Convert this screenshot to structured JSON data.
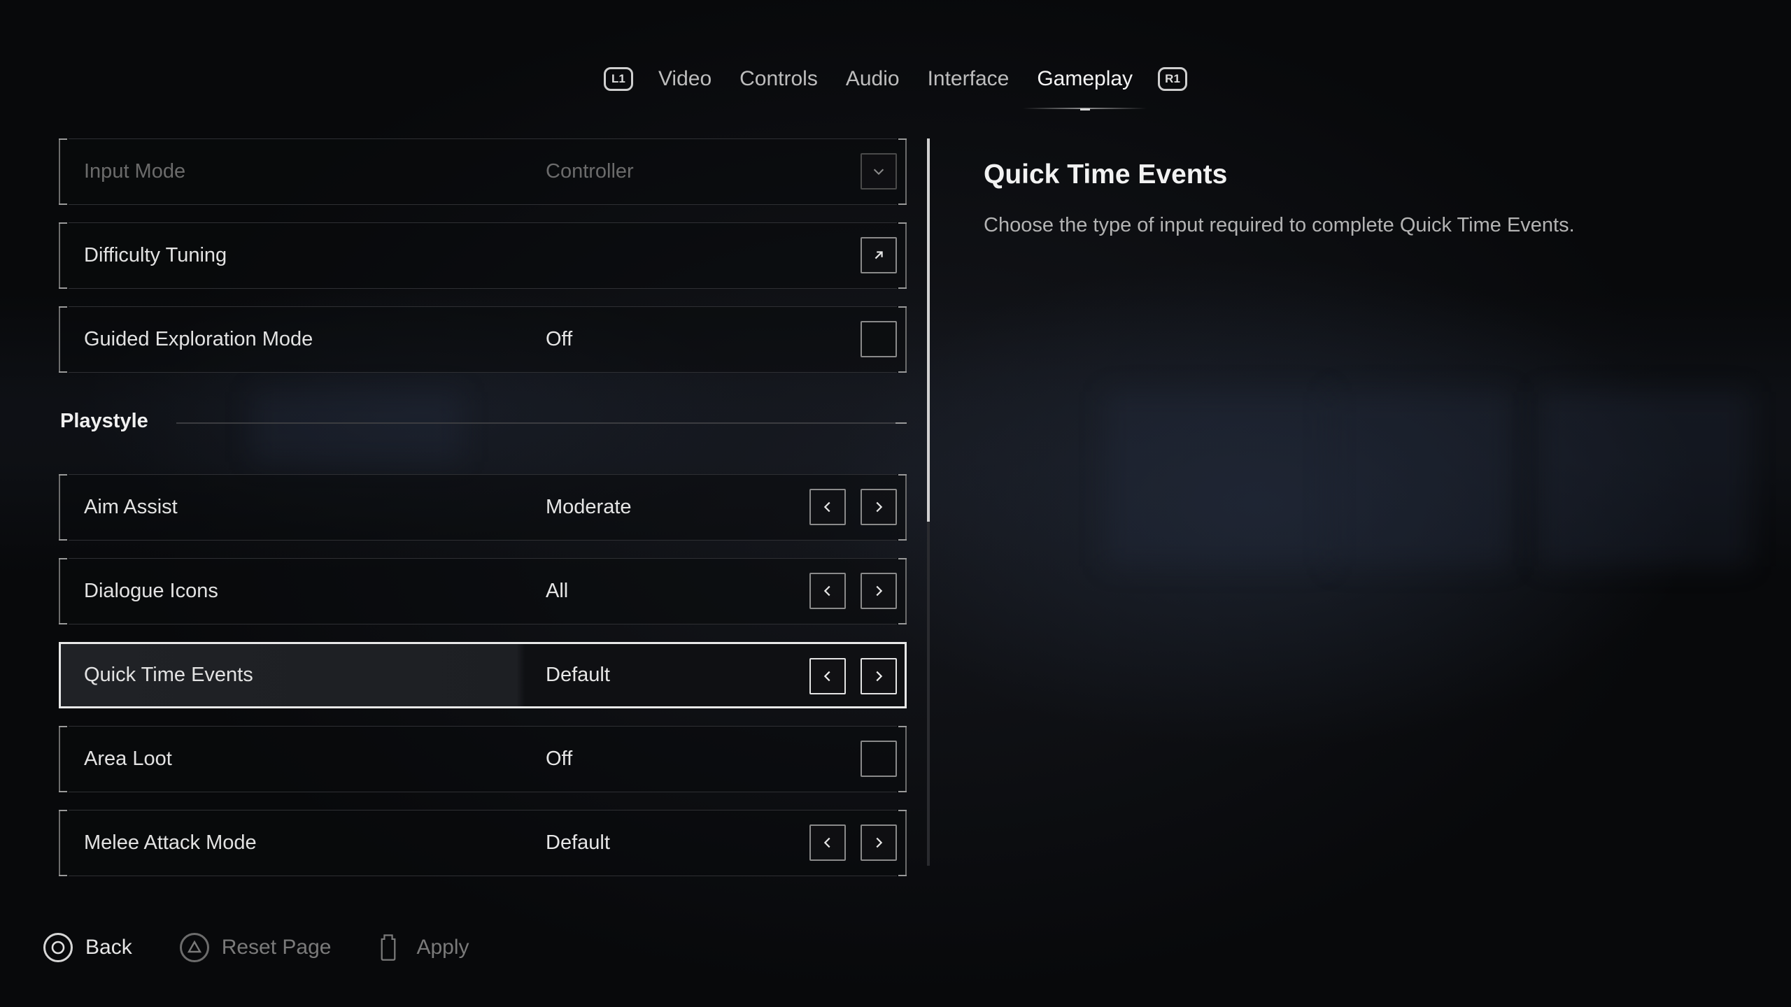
{
  "tabs": {
    "left_shoulder": "L1",
    "right_shoulder": "R1",
    "items": [
      {
        "label": "Video"
      },
      {
        "label": "Controls"
      },
      {
        "label": "Audio"
      },
      {
        "label": "Interface"
      },
      {
        "label": "Gameplay",
        "active": true
      }
    ]
  },
  "settings": {
    "input_mode": {
      "label": "Input Mode",
      "value": "Controller",
      "icon": "chevron-down-icon"
    },
    "difficulty_tuning": {
      "label": "Difficulty Tuning",
      "icon": "arrow-up-right-icon"
    },
    "guided_exploration": {
      "label": "Guided Exploration Mode",
      "value": "Off"
    },
    "section_playstyle": "Playstyle",
    "aim_assist": {
      "label": "Aim Assist",
      "value": "Moderate"
    },
    "dialogue_icons": {
      "label": "Dialogue Icons",
      "value": "All"
    },
    "quick_time_events": {
      "label": "Quick Time Events",
      "value": "Default",
      "selected": true
    },
    "area_loot": {
      "label": "Area Loot",
      "value": "Off"
    },
    "melee_attack_mode": {
      "label": "Melee Attack Mode",
      "value": "Default"
    }
  },
  "description": {
    "title": "Quick Time Events",
    "text": "Choose the type of input required to complete Quick Time Events."
  },
  "footer": {
    "back": {
      "label": "Back",
      "icon": "circle-button-icon"
    },
    "reset": {
      "label": "Reset Page",
      "icon": "triangle-button-icon"
    },
    "apply": {
      "label": "Apply",
      "icon": "touchpad-icon"
    }
  },
  "colors": {
    "background": "#0b0c0f",
    "selected_border": "#e8e8e8",
    "text_primary": "#e6e6e6",
    "text_dim": "#6b6b6b"
  }
}
